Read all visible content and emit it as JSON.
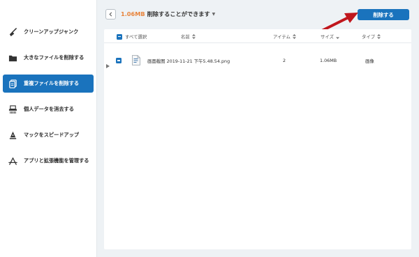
{
  "sidebar": {
    "items": [
      {
        "label": "クリーンアップジャンク",
        "icon": "broom-icon"
      },
      {
        "label": "大きなファイルを削除する",
        "icon": "folder-icon"
      },
      {
        "label": "重複ファイルを削除する",
        "icon": "duplicate-files-icon",
        "active": true
      },
      {
        "label": "個人データを消去する",
        "icon": "shredder-icon"
      },
      {
        "label": "マックをスピードアップ",
        "icon": "rocket-icon"
      },
      {
        "label": "アプリと拡張機能を管理する",
        "icon": "apps-icon"
      }
    ]
  },
  "toolbar": {
    "size": "1.06MB",
    "summary_text": "削除することができます",
    "delete_label": "削除する"
  },
  "table": {
    "select_all_label": "すべて選択",
    "columns": {
      "name": "名前",
      "items": "アイテム",
      "size": "サイズ",
      "type": "タイプ"
    },
    "rows": [
      {
        "name": "画面截图 2019-11-21 下午5.48.54.png",
        "items": "2",
        "size": "1.06MB",
        "type": "画像"
      }
    ]
  },
  "colors": {
    "accent": "#1a73bd",
    "size_highlight": "#e8833a",
    "arrow": "#c0171d"
  }
}
